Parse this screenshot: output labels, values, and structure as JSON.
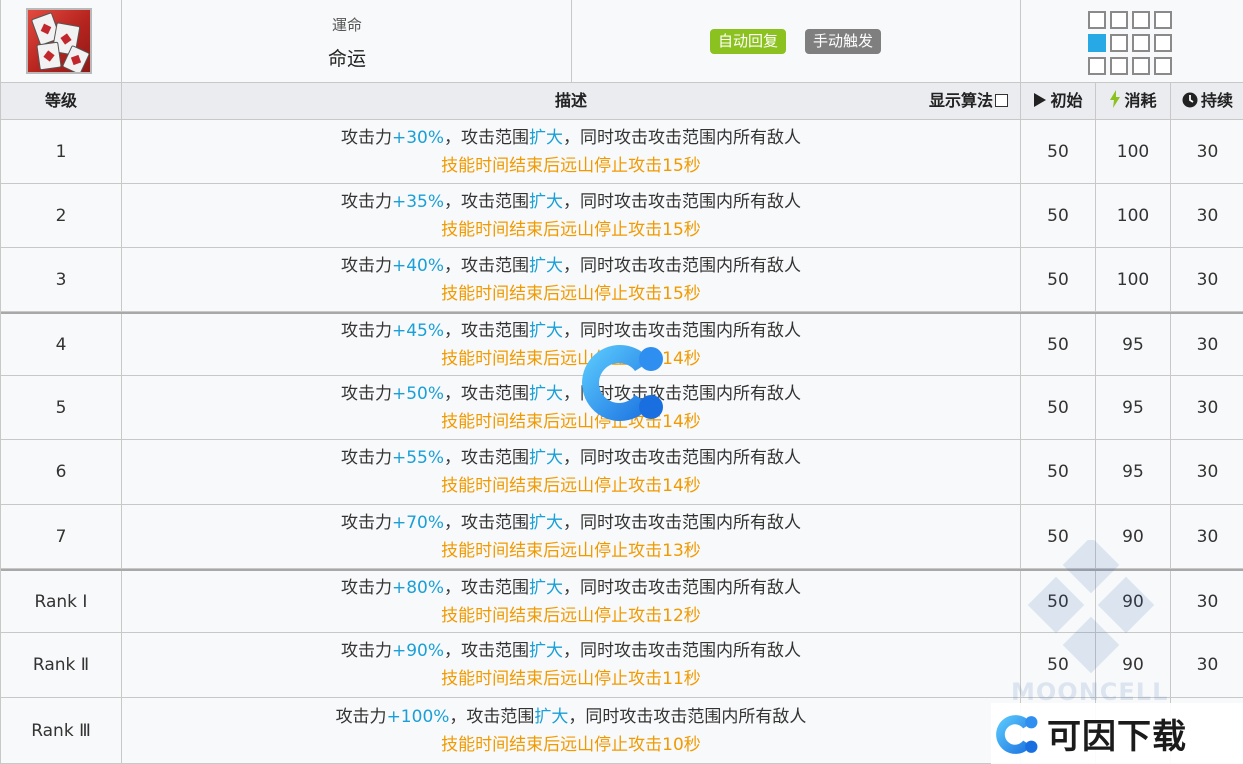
{
  "skill": {
    "name_original": "運命",
    "name": "命运",
    "tags": [
      "自动回复",
      "手动触发"
    ]
  },
  "range_grid": {
    "rows": 3,
    "cols": 4,
    "active": [
      [
        1,
        0
      ]
    ]
  },
  "table": {
    "headers": {
      "level": "等级",
      "description": "描述",
      "show_formula": "显示算法",
      "initial": "初始",
      "cost": "消耗",
      "duration": "持续"
    },
    "rows": [
      {
        "level": "1",
        "atk": "+30%",
        "seconds": "15秒",
        "initial": "50",
        "cost": "100",
        "duration": "30"
      },
      {
        "level": "2",
        "atk": "+35%",
        "seconds": "15秒",
        "initial": "50",
        "cost": "100",
        "duration": "30"
      },
      {
        "level": "3",
        "atk": "+40%",
        "seconds": "15秒",
        "initial": "50",
        "cost": "100",
        "duration": "30"
      },
      {
        "level": "4",
        "atk": "+45%",
        "seconds": "14秒",
        "initial": "50",
        "cost": "95",
        "duration": "30"
      },
      {
        "level": "5",
        "atk": "+50%",
        "seconds": "14秒",
        "initial": "50",
        "cost": "95",
        "duration": "30"
      },
      {
        "level": "6",
        "atk": "+55%",
        "seconds": "14秒",
        "initial": "50",
        "cost": "95",
        "duration": "30"
      },
      {
        "level": "7",
        "atk": "+70%",
        "seconds": "13秒",
        "initial": "50",
        "cost": "90",
        "duration": "30"
      },
      {
        "level": "Rank Ⅰ",
        "atk": "+80%",
        "seconds": "12秒",
        "initial": "50",
        "cost": "90",
        "duration": "30"
      },
      {
        "level": "Rank Ⅱ",
        "atk": "+90%",
        "seconds": "11秒",
        "initial": "50",
        "cost": "90",
        "duration": "30"
      },
      {
        "level": "Rank Ⅲ",
        "atk": "+100%",
        "seconds": "10秒",
        "initial": "",
        "cost": "",
        "duration": ""
      }
    ],
    "desc_parts": {
      "prefix": "攻击力",
      "mid": "，攻击范围",
      "expand": "扩大",
      "suffix": "，同时攻击攻击范围内所有敌人",
      "line2_prefix": "技能时间结束后远山停止攻击"
    }
  },
  "watermarks": {
    "moon": "MOONCELL",
    "brand": "可因下载"
  },
  "colors": {
    "blue_value": "#1aa0d8",
    "orange_note": "#f19a00",
    "tag_green": "#8cc21f",
    "tag_gray": "#7f7f7f",
    "range_active": "#27a9e6"
  },
  "icons": {
    "initial": "play-icon",
    "cost": "lightning-icon",
    "duration": "clock-icon"
  }
}
